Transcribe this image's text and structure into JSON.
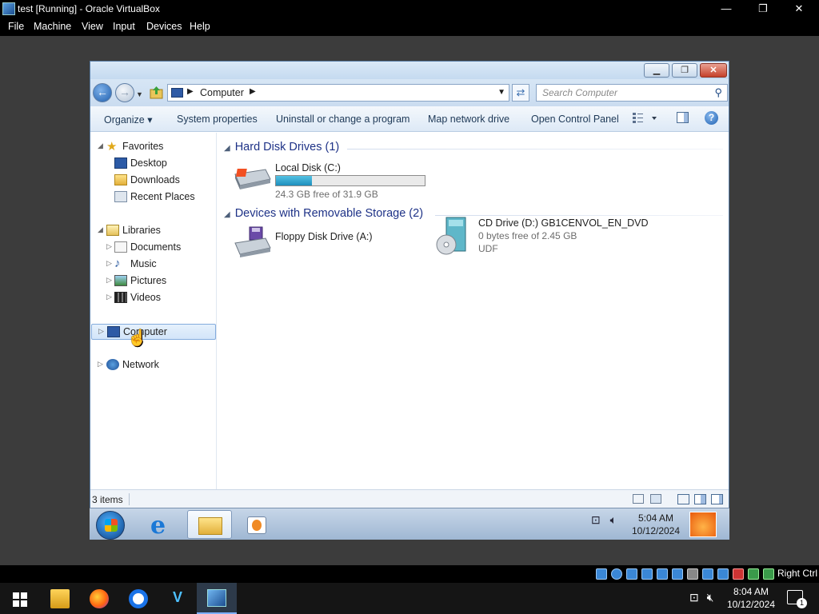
{
  "host": {
    "window_title": "test [Running] - Oracle VirtualBox",
    "menu": [
      "File",
      "Machine",
      "View",
      "Input",
      "Devices",
      "Help"
    ],
    "window_controls": {
      "minimize": "—",
      "maximize": "❐",
      "close": "✕"
    },
    "status_right": "Right Ctrl",
    "taskbar_time": "8:04 AM",
    "taskbar_date": "10/12/2024",
    "notification_count": "1"
  },
  "explorer": {
    "address_crumb": "Computer",
    "search_placeholder": "Search Computer",
    "toolbar": {
      "organize": "Organize ▾",
      "system_properties": "System properties",
      "uninstall": "Uninstall or change a program",
      "map_drive": "Map network drive",
      "control_panel": "Open Control Panel"
    },
    "nav": {
      "favorites": "Favorites",
      "desktop": "Desktop",
      "downloads": "Downloads",
      "recent_places": "Recent Places",
      "libraries": "Libraries",
      "documents": "Documents",
      "music": "Music",
      "pictures": "Pictures",
      "videos": "Videos",
      "computer": "Computer",
      "network": "Network"
    },
    "groups": {
      "hdd_title": "Hard Disk Drives (1)",
      "removable_title": "Devices with Removable Storage (2)"
    },
    "drives": {
      "c": {
        "name": "Local Disk (C:)",
        "free": "24.3 GB free of 31.9 GB",
        "used_fraction": 0.24
      },
      "a": {
        "name": "Floppy Disk Drive (A:)"
      },
      "d": {
        "name": "CD Drive (D:) GB1CENVOL_EN_DVD",
        "free": "0 bytes free of 2.45 GB",
        "fs": "UDF"
      }
    },
    "status_count": "3 items"
  },
  "guest_taskbar": {
    "time": "5:04 AM",
    "date": "10/12/2024"
  },
  "colors": {
    "accent": "#1e3287",
    "selection": "#d2e5f9",
    "capacity_fill": "#1e8fbd"
  }
}
